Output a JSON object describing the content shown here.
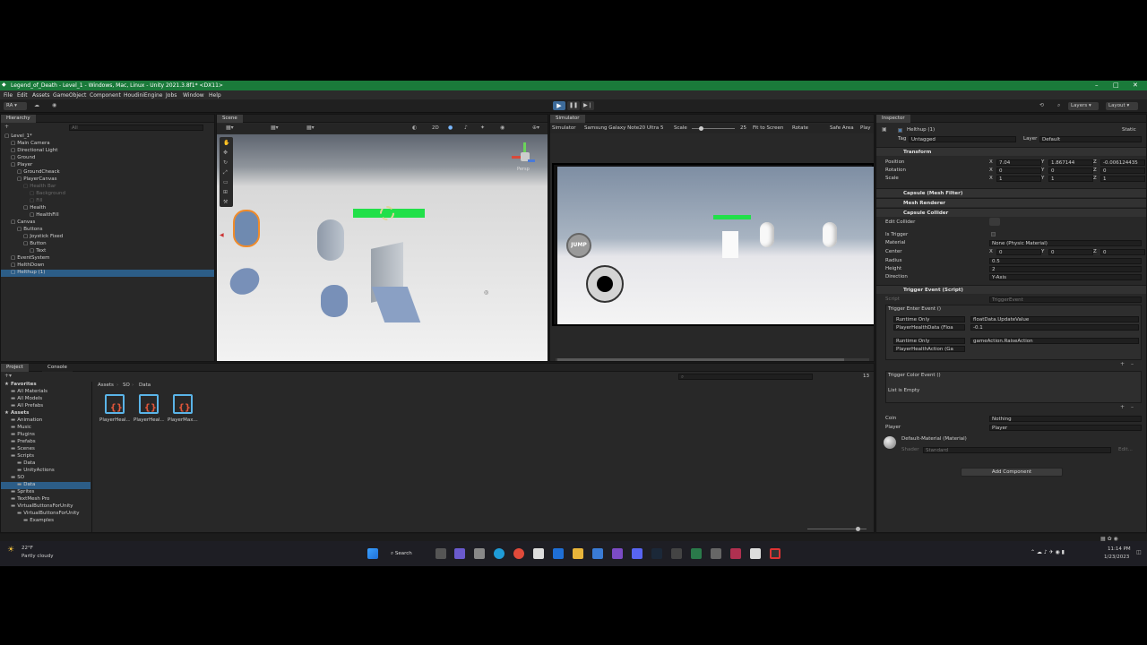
{
  "window": {
    "title": "Legend_of_Death - Level_1 - Windows, Mac, Linux - Unity 2021.3.8f1* <DX11>"
  },
  "menu": [
    "File",
    "Edit",
    "Assets",
    "GameObject",
    "Component",
    "HoudiniEngine",
    "Jobs",
    "Window",
    "Help"
  ],
  "toolbar": {
    "account": "RA",
    "layers": "Layers",
    "layout": "Layout"
  },
  "hierarchy": {
    "tab": "Hierarchy",
    "search_placeholder": "All",
    "items": [
      {
        "label": "Level_1*",
        "depth": 0,
        "dim": false
      },
      {
        "label": "Main Camera",
        "depth": 1,
        "dim": false
      },
      {
        "label": "Directional Light",
        "depth": 1,
        "dim": false
      },
      {
        "label": "Ground",
        "depth": 1,
        "dim": false
      },
      {
        "label": "Player",
        "depth": 1,
        "dim": false
      },
      {
        "label": "GroundCheack",
        "depth": 2,
        "dim": false
      },
      {
        "label": "PlayerCanvas",
        "depth": 2,
        "dim": false
      },
      {
        "label": "Health Bar",
        "depth": 3,
        "dim": true
      },
      {
        "label": "Background",
        "depth": 4,
        "dim": true
      },
      {
        "label": "Fill",
        "depth": 4,
        "dim": true
      },
      {
        "label": "Health",
        "depth": 3,
        "dim": false
      },
      {
        "label": "HealthFill",
        "depth": 4,
        "dim": false
      },
      {
        "label": "Canvas",
        "depth": 1,
        "dim": false
      },
      {
        "label": "Buttons",
        "depth": 2,
        "dim": false
      },
      {
        "label": "Joystick Fixed",
        "depth": 3,
        "dim": false
      },
      {
        "label": "Button",
        "depth": 3,
        "dim": false
      },
      {
        "label": "Text",
        "depth": 4,
        "dim": false
      },
      {
        "label": "EventSystem",
        "depth": 1,
        "dim": false
      },
      {
        "label": "HelthDown",
        "depth": 1,
        "dim": false
      },
      {
        "label": "Helthup (1)",
        "depth": 1,
        "dim": false,
        "selected": true
      }
    ]
  },
  "scene": {
    "tab": "Scene",
    "mode": "2D",
    "view": "Persp"
  },
  "simulator": {
    "tab": "Simulator",
    "mode": "Simulator",
    "device": "Samsung Galaxy Note20 Ultra 5",
    "scale_label": "Scale",
    "scale_value": "25",
    "fit": "Fit to Screen",
    "rotate": "Rotate",
    "safe_area": "Safe Area",
    "play": "Play",
    "jump_label": "JUMP"
  },
  "project": {
    "tabs": [
      "Project",
      "Console"
    ],
    "breadcrumb": [
      "Assets",
      "SO",
      "Data"
    ],
    "badge": "13",
    "tree": [
      {
        "label": "Favorites",
        "depth": 0,
        "bold": true
      },
      {
        "label": "All Materials",
        "depth": 1
      },
      {
        "label": "All Models",
        "depth": 1
      },
      {
        "label": "All Prefabs",
        "depth": 1
      },
      {
        "label": "Assets",
        "depth": 0,
        "bold": true
      },
      {
        "label": "Animation",
        "depth": 1
      },
      {
        "label": "Music",
        "depth": 1
      },
      {
        "label": "Plugins",
        "depth": 1
      },
      {
        "label": "Prefabs",
        "depth": 1
      },
      {
        "label": "Scenes",
        "depth": 1
      },
      {
        "label": "Scripts",
        "depth": 1
      },
      {
        "label": "Data",
        "depth": 2
      },
      {
        "label": "UnityActions",
        "depth": 2
      },
      {
        "label": "SO",
        "depth": 1
      },
      {
        "label": "Data",
        "depth": 2,
        "selected": true
      },
      {
        "label": "Sprites",
        "depth": 1
      },
      {
        "label": "TextMesh Pro",
        "depth": 1
      },
      {
        "label": "VirtualButtonsForUnity",
        "depth": 1
      },
      {
        "label": "VirtualButtonsForUnity",
        "depth": 2
      },
      {
        "label": "Examples",
        "depth": 3
      }
    ],
    "assets": [
      "PlayerHeal...",
      "PlayerHeal...",
      "PlayerMax..."
    ]
  },
  "inspector": {
    "tab": "Inspector",
    "object_name": "Helthup (1)",
    "static_label": "Static",
    "tag_label": "Tag",
    "tag_value": "Untagged",
    "layer_label": "Layer",
    "layer_value": "Default",
    "transform": {
      "title": "Transform",
      "position_label": "Position",
      "position": [
        "7.04",
        "1.867144",
        "-0.006124435"
      ],
      "rotation_label": "Rotation",
      "rotation": [
        "0",
        "0",
        "0"
      ],
      "scale_label": "Scale",
      "scale": [
        "1",
        "1",
        "1"
      ]
    },
    "components": [
      "Capsule (Mesh Filter)",
      "Mesh Renderer",
      "Capsule Collider"
    ],
    "collider": {
      "edit_label": "Edit Collider",
      "trigger_label": "Is Trigger",
      "material_label": "Material",
      "material_value": "None (Physic Material)",
      "center_label": "Center",
      "center": [
        "0",
        "0",
        "0"
      ],
      "radius_label": "Radius",
      "radius": "0.5",
      "height_label": "Height",
      "height": "2",
      "direction_label": "Direction",
      "direction": "Y-Axis"
    },
    "trigger_event": {
      "title": "Trigger Event (Script)",
      "script_label": "Script",
      "script_value": "TriggerEvent",
      "enter_title": "Trigger Enter Event ()",
      "runtime1": "Runtime Only",
      "method1": "floatData.UpdateValue",
      "object1": "PlayerHealthData (Floa",
      "arg1": "-0.1",
      "runtime2": "Runtime Only",
      "method2": "gameAction.RaiseAction",
      "object2": "PlayerHealthAction (Ga",
      "color_title": "Trigger Color Event ()",
      "empty": "List is Empty",
      "coin_label": "Coin",
      "coin_value": "Nothing",
      "player_label": "Player",
      "player_value": "Player"
    },
    "material": {
      "name": "Default-Material (Material)",
      "shader_label": "Shader",
      "shader_value": "Standard",
      "edit": "Edit..."
    },
    "add_component": "Add Component"
  },
  "taskbar": {
    "temp": "22°F",
    "weather": "Partly cloudy",
    "search": "Search",
    "time": "11:14 PM",
    "date": "1/23/2023"
  },
  "colors": {
    "accent": "#2c5d87",
    "titlebar": "#1a7a3a",
    "health": "#22e04a"
  }
}
